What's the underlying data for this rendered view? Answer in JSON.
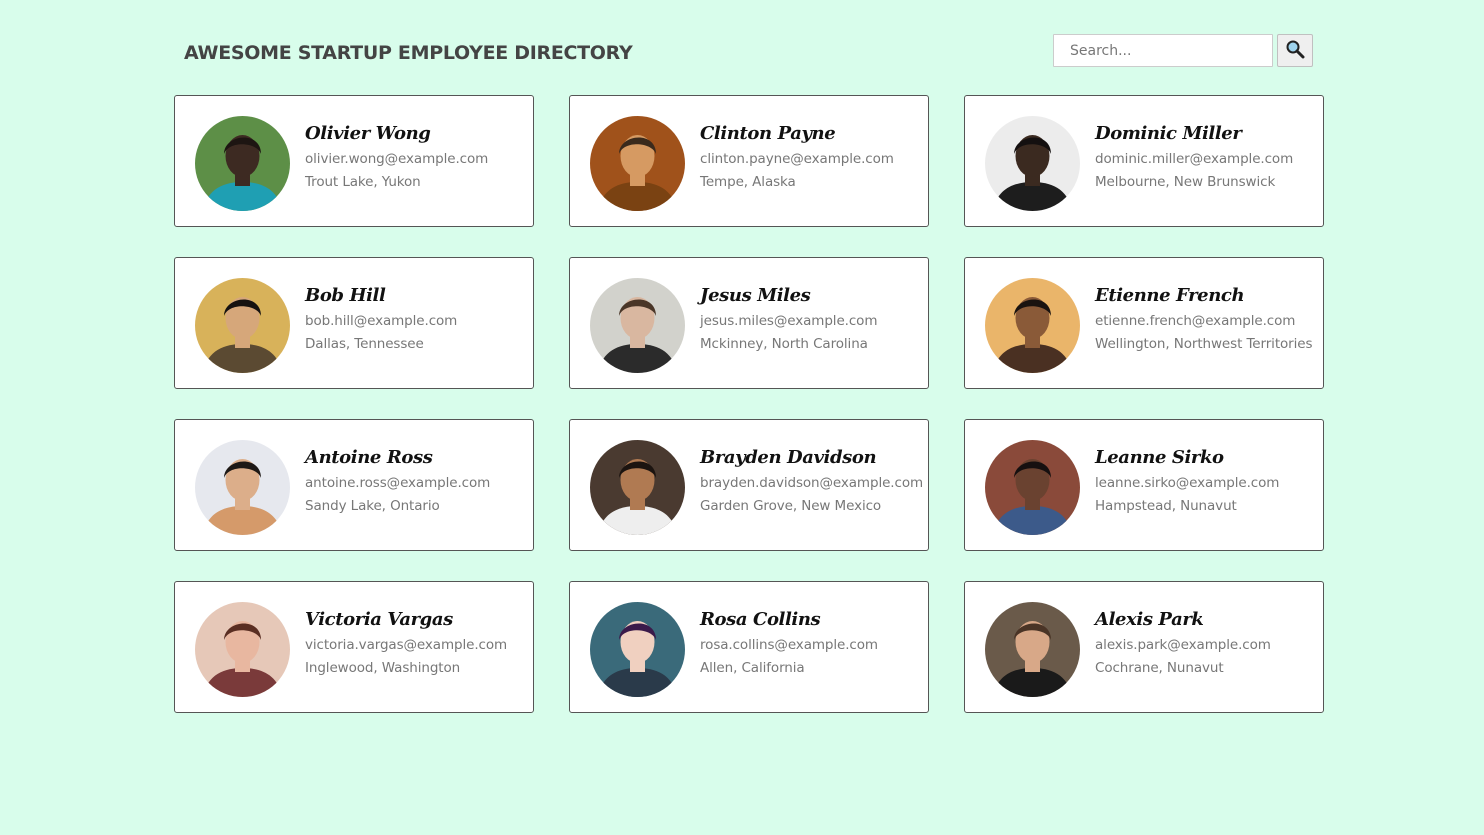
{
  "header": {
    "title": "AWESOME STARTUP EMPLOYEE DIRECTORY",
    "search_placeholder": "Search...",
    "search_value": "",
    "search_button_icon": "magnifier-icon"
  },
  "employees": [
    {
      "name": "Olivier Wong",
      "email": "olivier.wong@example.com",
      "location": "Trout Lake, Yukon",
      "avatar": {
        "bg": "#5d8f47",
        "skin": "#3d2a22",
        "hair": "#1d1512",
        "shirt": "#1f9fb3"
      }
    },
    {
      "name": "Clinton Payne",
      "email": "clinton.payne@example.com",
      "location": "Tempe, Alaska",
      "avatar": {
        "bg": "#a0521b",
        "skin": "#d69a62",
        "hair": "#3a2a1c",
        "shirt": "#7a4212"
      }
    },
    {
      "name": "Dominic Miller",
      "email": "dominic.miller@example.com",
      "location": "Melbourne, New Brunswick",
      "avatar": {
        "bg": "#ececec",
        "skin": "#3b2a20",
        "hair": "#141010",
        "shirt": "#1d1d1d"
      }
    },
    {
      "name": "Bob Hill",
      "email": "bob.hill@example.com",
      "location": "Dallas, Tennessee",
      "avatar": {
        "bg": "#d8b25a",
        "skin": "#d6a77a",
        "hair": "#161210",
        "shirt": "#5b4a32"
      }
    },
    {
      "name": "Jesus Miles",
      "email": "jesus.miles@example.com",
      "location": "Mckinney, North Carolina",
      "avatar": {
        "bg": "#d2d2cc",
        "skin": "#d9b7a0",
        "hair": "#4a3628",
        "shirt": "#2b2b2b"
      }
    },
    {
      "name": "Etienne French",
      "email": "etienne.french@example.com",
      "location": "Wellington, Northwest Territories",
      "avatar": {
        "bg": "#eab56a",
        "skin": "#8a5a38",
        "hair": "#1a1310",
        "shirt": "#4a3022"
      }
    },
    {
      "name": "Antoine Ross",
      "email": "antoine.ross@example.com",
      "location": "Sandy Lake, Ontario",
      "avatar": {
        "bg": "#e6e8ee",
        "skin": "#dcae8a",
        "hair": "#1e1916",
        "shirt": "#d59a6a"
      }
    },
    {
      "name": "Brayden Davidson",
      "email": "brayden.davidson@example.com",
      "location": "Garden Grove, New Mexico",
      "avatar": {
        "bg": "#4a3a30",
        "skin": "#b07a52",
        "hair": "#1c1410",
        "shirt": "#eeeeee"
      }
    },
    {
      "name": "Leanne Sirko",
      "email": "leanne.sirko@example.com",
      "location": "Hampstead, Nunavut",
      "avatar": {
        "bg": "#8a4a3a",
        "skin": "#6a4230",
        "hair": "#161010",
        "shirt": "#3c5a8a"
      }
    },
    {
      "name": "Victoria Vargas",
      "email": "victoria.vargas@example.com",
      "location": "Inglewood, Washington",
      "avatar": {
        "bg": "#e6c8b8",
        "skin": "#e8b7a0",
        "hair": "#5a2e22",
        "shirt": "#7a3a3a"
      }
    },
    {
      "name": "Rosa Collins",
      "email": "rosa.collins@example.com",
      "location": "Allen, California",
      "avatar": {
        "bg": "#3a6a7a",
        "skin": "#f0d0c0",
        "hair": "#3a1a4a",
        "shirt": "#2a3a4a"
      }
    },
    {
      "name": "Alexis Park",
      "email": "alexis.park@example.com",
      "location": "Cochrane, Nunavut",
      "avatar": {
        "bg": "#6a5a4a",
        "skin": "#d8a888",
        "hair": "#4a3426",
        "shirt": "#1a1a1a"
      }
    }
  ]
}
